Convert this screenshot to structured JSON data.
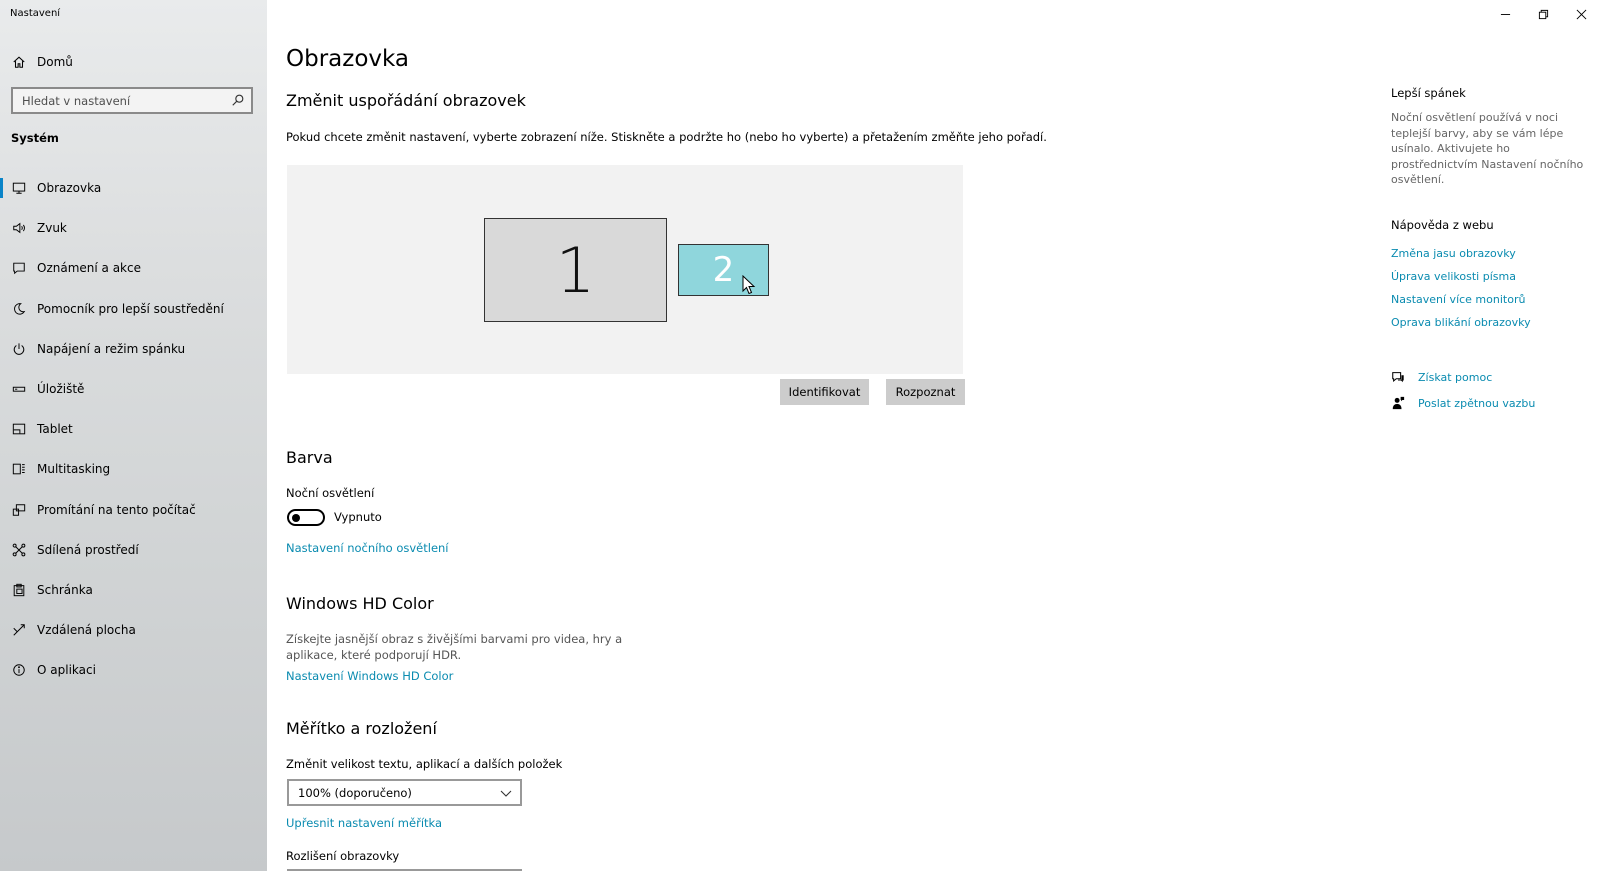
{
  "window": {
    "title": "Nastavení"
  },
  "sidebar": {
    "home_label": "Domů",
    "search_placeholder": "Hledat v nastavení",
    "section": "Systém",
    "items": [
      {
        "label": "Obrazovka",
        "icon": "monitor-icon"
      },
      {
        "label": "Zvuk",
        "icon": "speaker-icon"
      },
      {
        "label": "Oznámení a akce",
        "icon": "notification-icon"
      },
      {
        "label": "Pomocník pro lepší soustředění",
        "icon": "moon-icon"
      },
      {
        "label": "Napájení a režim spánku",
        "icon": "power-icon"
      },
      {
        "label": "Úložiště",
        "icon": "storage-icon"
      },
      {
        "label": "Tablet",
        "icon": "tablet-icon"
      },
      {
        "label": "Multitasking",
        "icon": "multitasking-icon"
      },
      {
        "label": "Promítání na tento počítač",
        "icon": "projecting-icon"
      },
      {
        "label": "Sdílená prostředí",
        "icon": "shared-icon"
      },
      {
        "label": "Schránka",
        "icon": "clipboard-icon"
      },
      {
        "label": "Vzdálená plocha",
        "icon": "remote-desktop-icon"
      },
      {
        "label": "O aplikaci",
        "icon": "info-icon"
      }
    ]
  },
  "main": {
    "title": "Obrazovka",
    "arrange": {
      "heading": "Změnit uspořádání obrazovek",
      "description": "Pokud chcete změnit nastavení, vyberte zobrazení níže. Stiskněte a podržte ho (nebo ho vyberte) a přetažením změňte jeho pořadí.",
      "monitor1": "1",
      "monitor2": "2",
      "identify_label": "Identifikovat",
      "detect_label": "Rozpoznat"
    },
    "color": {
      "heading": "Barva",
      "night_light_label": "Noční osvětlení",
      "toggle_state": "Vypnuto",
      "night_light_link": "Nastavení nočního osvětlení"
    },
    "hd_color": {
      "heading": "Windows HD Color",
      "description": "Získejte jasnější obraz s živějšími barvami pro videa, hry a aplikace, které podporují HDR.",
      "link": "Nastavení Windows HD Color"
    },
    "scale": {
      "heading": "Měřítko a rozložení",
      "size_label": "Změnit velikost textu, aplikací a dalších položek",
      "size_value": "100% (doporučeno)",
      "advanced_link": "Upřesnit nastavení měřítka",
      "resolution_label": "Rozlišení obrazovky"
    }
  },
  "right_panel": {
    "sleep": {
      "heading": "Lepší spánek",
      "text": "Noční osvětlení používá v noci teplejší barvy, aby se vám lépe usínalo. Aktivujete ho prostřednictvím Nastavení nočního osvětlení."
    },
    "web_help": {
      "heading": "Nápověda z webu",
      "links": [
        "Změna jasu obrazovky",
        "Úprava velikosti písma",
        "Nastavení více monitorů",
        "Oprava blikání obrazovky"
      ]
    },
    "get_help": "Získat pomoc",
    "feedback": "Poslat zpětnou vazbu"
  },
  "colors": {
    "accent": "#0a84c8",
    "link": "#0a8bb0",
    "monitor2": "#8fd6dc"
  }
}
